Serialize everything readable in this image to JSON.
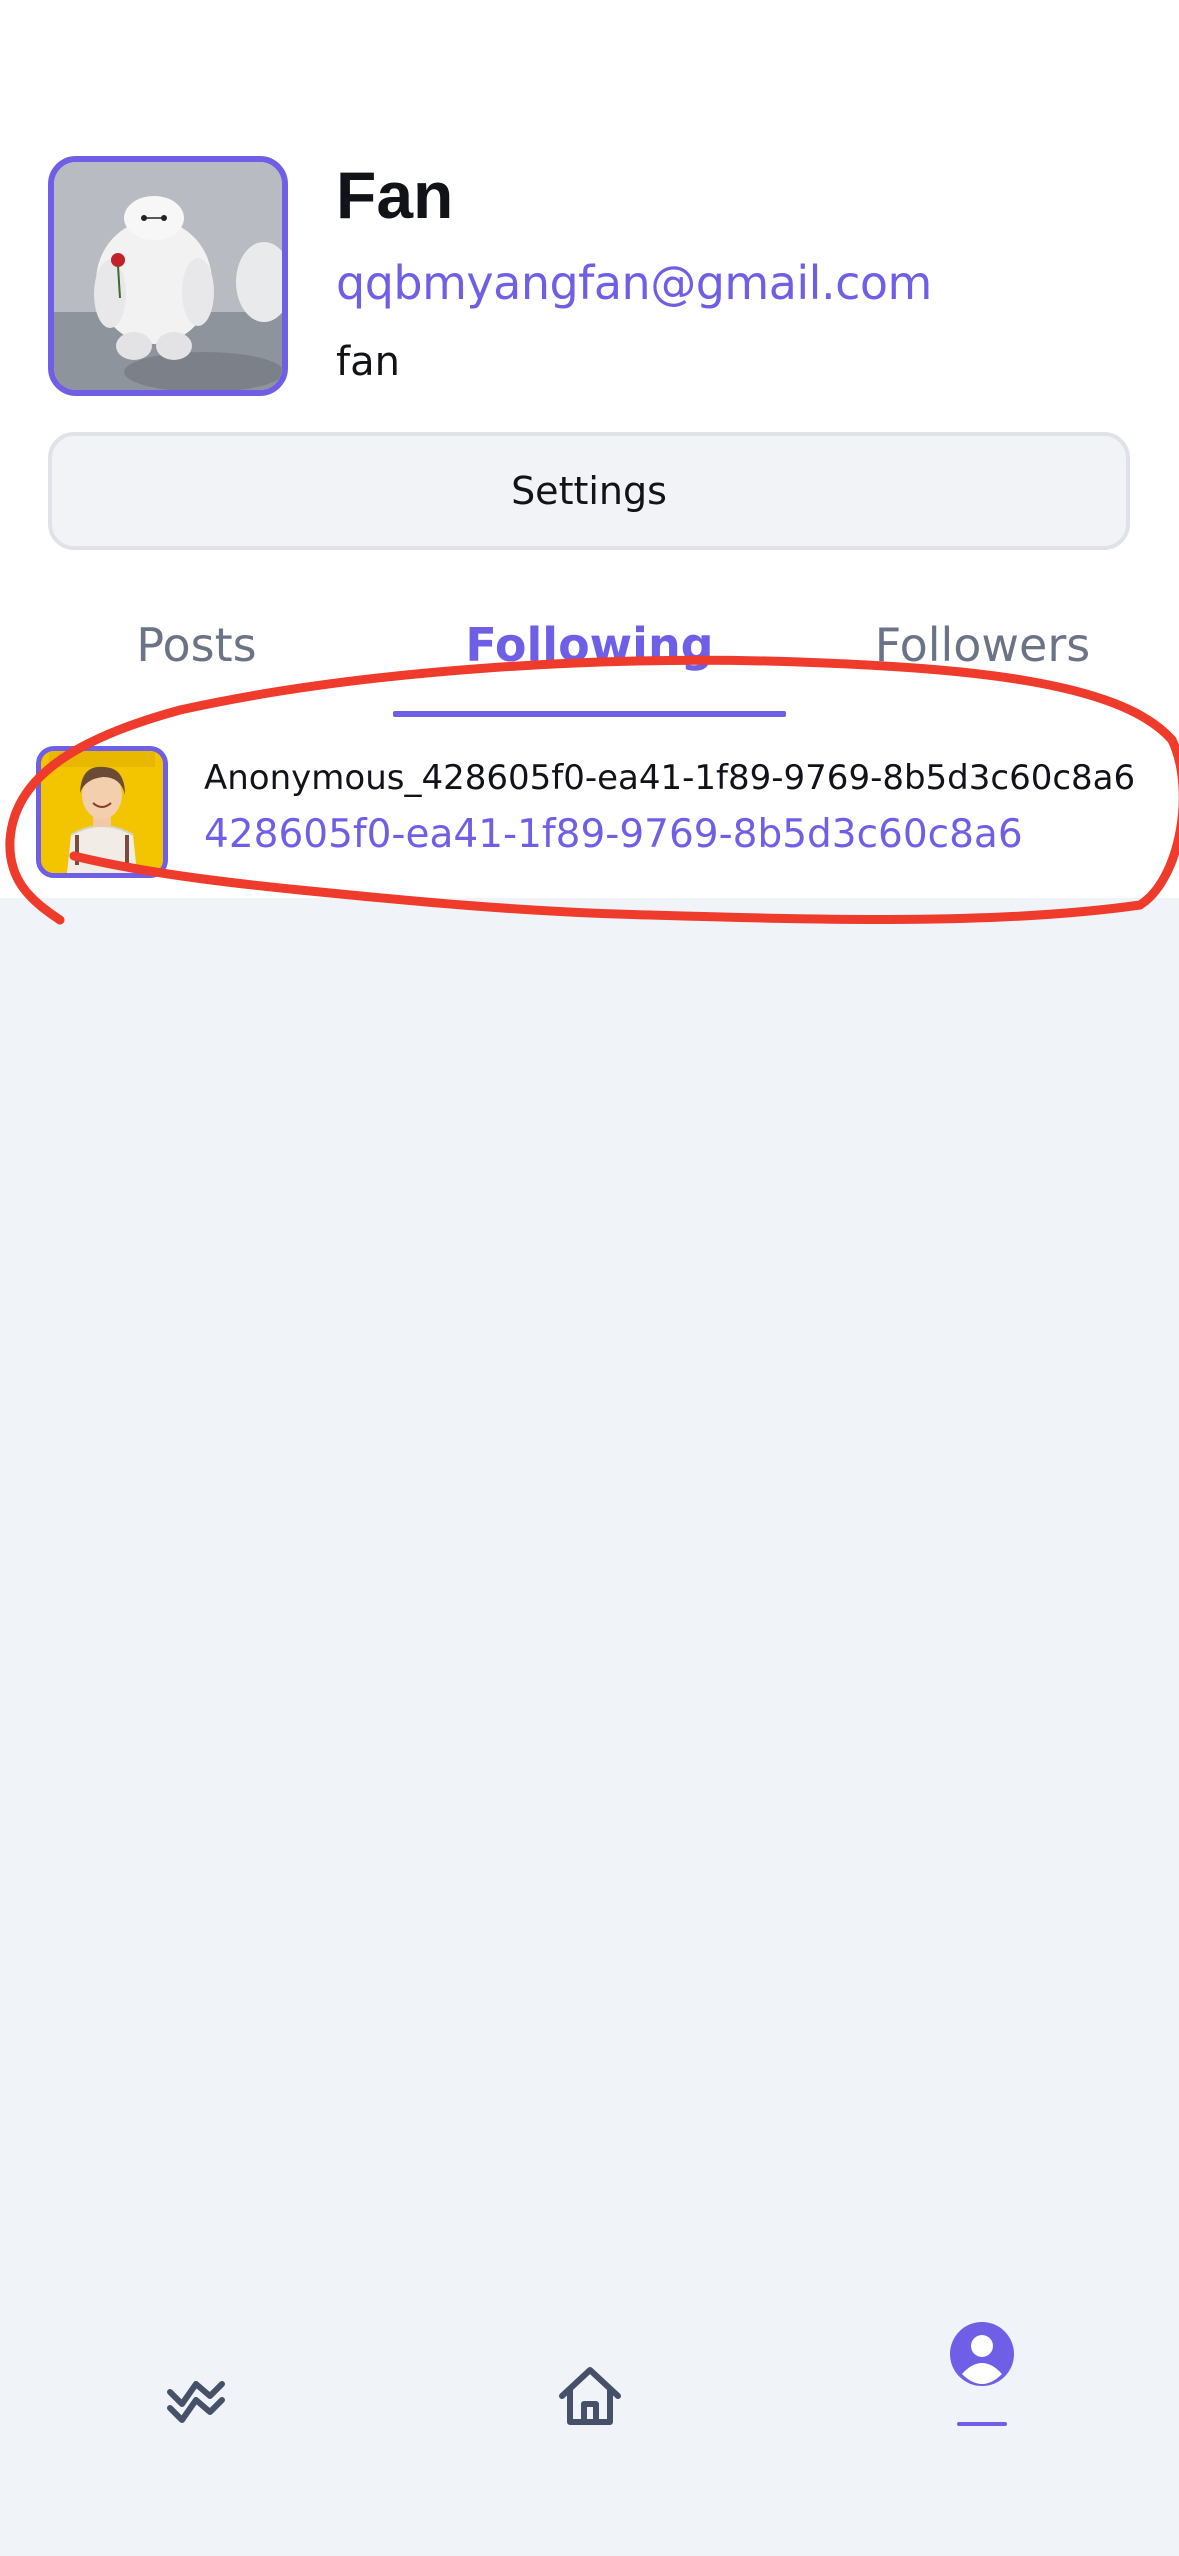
{
  "profile": {
    "name": "Fan",
    "email": "qqbmyangfan@gmail.com",
    "handle": "fan",
    "settings_label": "Settings"
  },
  "tabs": [
    {
      "label": "Posts",
      "active": false
    },
    {
      "label": "Following",
      "active": true
    },
    {
      "label": "Followers",
      "active": false
    }
  ],
  "following": [
    {
      "name": "Anonymous_428605f0-ea41-1f89-9769-8b5d3c60c8a6",
      "id": "428605f0-ea41-1f89-9769-8b5d3c60c8a6"
    }
  ],
  "nav": [
    {
      "icon": "activity-chart-icon",
      "active": false
    },
    {
      "icon": "home-icon",
      "active": false
    },
    {
      "icon": "user-profile-icon",
      "active": true
    }
  ],
  "colors": {
    "accent": "#6f5ee6",
    "text": "#111318",
    "muted": "#6b7387",
    "background": "#f0f3f8",
    "annotation": "#ef3b2c"
  }
}
